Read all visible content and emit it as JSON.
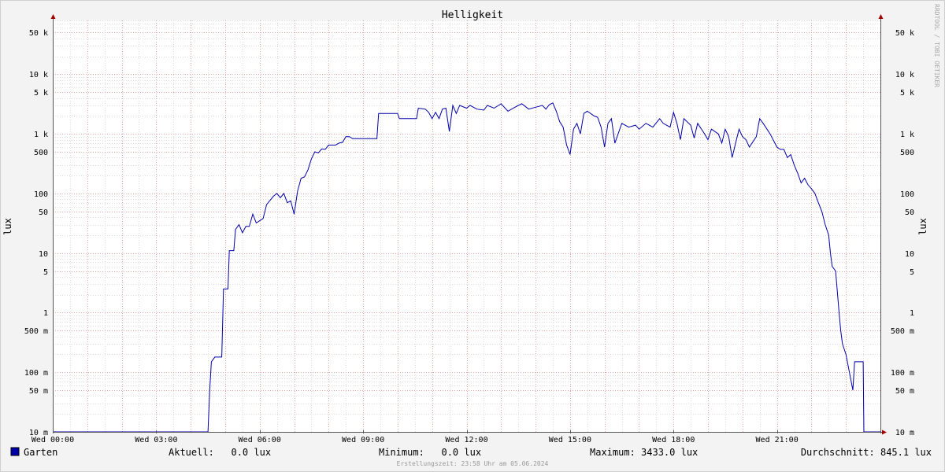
{
  "chart_data": {
    "type": "line",
    "title": "Helligkeit",
    "ylabel": "lux",
    "ylabel_right": "lux",
    "watermark": "RRDTOOL / TOBI OETIKER",
    "yscale": "log",
    "ylim": [
      0.01,
      80000
    ],
    "xlim_hours": [
      0,
      24
    ],
    "y_ticks": [
      {
        "v": 50000,
        "label": "50 k"
      },
      {
        "v": 10000,
        "label": "10 k"
      },
      {
        "v": 5000,
        "label": "5 k"
      },
      {
        "v": 1000,
        "label": "1 k"
      },
      {
        "v": 500,
        "label": "500"
      },
      {
        "v": 100,
        "label": "100"
      },
      {
        "v": 50,
        "label": "50"
      },
      {
        "v": 10,
        "label": "10"
      },
      {
        "v": 5,
        "label": "5"
      },
      {
        "v": 1,
        "label": "1"
      },
      {
        "v": 0.5,
        "label": "500 m"
      },
      {
        "v": 0.1,
        "label": "100 m"
      },
      {
        "v": 0.05,
        "label": "50 m"
      },
      {
        "v": 0.01,
        "label": "10 m"
      }
    ],
    "x_ticks": [
      {
        "h": 0,
        "label": "Wed 00:00"
      },
      {
        "h": 3,
        "label": "Wed 03:00"
      },
      {
        "h": 6,
        "label": "Wed 06:00"
      },
      {
        "h": 9,
        "label": "Wed 09:00"
      },
      {
        "h": 12,
        "label": "Wed 12:00"
      },
      {
        "h": 15,
        "label": "Wed 15:00"
      },
      {
        "h": 18,
        "label": "Wed 18:00"
      },
      {
        "h": 21,
        "label": "Wed 21:00"
      }
    ],
    "series": [
      {
        "name": "Garten",
        "color": "#0000aa",
        "points": [
          [
            0,
            0.01
          ],
          [
            4.5,
            0.01
          ],
          [
            4.55,
            0.05
          ],
          [
            4.6,
            0.15
          ],
          [
            4.7,
            0.18
          ],
          [
            4.9,
            0.18
          ],
          [
            4.95,
            2.5
          ],
          [
            5.08,
            2.5
          ],
          [
            5.12,
            11
          ],
          [
            5.25,
            11
          ],
          [
            5.3,
            25
          ],
          [
            5.4,
            30
          ],
          [
            5.5,
            22
          ],
          [
            5.6,
            28
          ],
          [
            5.7,
            28
          ],
          [
            5.8,
            45
          ],
          [
            5.9,
            32
          ],
          [
            6.1,
            38
          ],
          [
            6.2,
            65
          ],
          [
            6.4,
            90
          ],
          [
            6.5,
            100
          ],
          [
            6.6,
            85
          ],
          [
            6.7,
            100
          ],
          [
            6.8,
            70
          ],
          [
            6.9,
            75
          ],
          [
            7.0,
            45
          ],
          [
            7.1,
            110
          ],
          [
            7.2,
            180
          ],
          [
            7.3,
            190
          ],
          [
            7.4,
            250
          ],
          [
            7.5,
            380
          ],
          [
            7.6,
            500
          ],
          [
            7.7,
            480
          ],
          [
            7.8,
            560
          ],
          [
            7.9,
            550
          ],
          [
            8.0,
            650
          ],
          [
            8.2,
            650
          ],
          [
            8.3,
            700
          ],
          [
            8.4,
            720
          ],
          [
            8.5,
            900
          ],
          [
            8.6,
            900
          ],
          [
            8.7,
            830
          ],
          [
            9.4,
            830
          ],
          [
            9.45,
            2200
          ],
          [
            10.0,
            2200
          ],
          [
            10.05,
            1800
          ],
          [
            10.55,
            1800
          ],
          [
            10.6,
            2700
          ],
          [
            10.8,
            2600
          ],
          [
            10.9,
            2300
          ],
          [
            11.0,
            1800
          ],
          [
            11.1,
            2300
          ],
          [
            11.2,
            1800
          ],
          [
            11.3,
            2600
          ],
          [
            11.4,
            2700
          ],
          [
            11.5,
            1100
          ],
          [
            11.6,
            3000
          ],
          [
            11.7,
            2200
          ],
          [
            11.8,
            3000
          ],
          [
            12.0,
            2700
          ],
          [
            12.1,
            3000
          ],
          [
            12.3,
            2600
          ],
          [
            12.5,
            2500
          ],
          [
            12.6,
            3000
          ],
          [
            12.8,
            2700
          ],
          [
            13.0,
            3200
          ],
          [
            13.2,
            2400
          ],
          [
            13.4,
            2800
          ],
          [
            13.6,
            3200
          ],
          [
            13.8,
            2600
          ],
          [
            14.0,
            2800
          ],
          [
            14.2,
            3000
          ],
          [
            14.3,
            2600
          ],
          [
            14.4,
            3100
          ],
          [
            14.5,
            3300
          ],
          [
            14.6,
            2400
          ],
          [
            14.7,
            1600
          ],
          [
            14.8,
            1300
          ],
          [
            14.9,
            650
          ],
          [
            15.0,
            450
          ],
          [
            15.1,
            1200
          ],
          [
            15.2,
            1500
          ],
          [
            15.3,
            1000
          ],
          [
            15.4,
            2200
          ],
          [
            15.5,
            2400
          ],
          [
            15.7,
            2000
          ],
          [
            15.8,
            1900
          ],
          [
            15.9,
            1300
          ],
          [
            16.0,
            600
          ],
          [
            16.1,
            1500
          ],
          [
            16.2,
            1800
          ],
          [
            16.3,
            700
          ],
          [
            16.5,
            1500
          ],
          [
            16.7,
            1300
          ],
          [
            16.9,
            1400
          ],
          [
            17.0,
            1200
          ],
          [
            17.2,
            1500
          ],
          [
            17.4,
            1300
          ],
          [
            17.6,
            1800
          ],
          [
            17.7,
            1500
          ],
          [
            17.9,
            1300
          ],
          [
            18.0,
            2300
          ],
          [
            18.1,
            1500
          ],
          [
            18.2,
            800
          ],
          [
            18.3,
            1800
          ],
          [
            18.5,
            1400
          ],
          [
            18.6,
            850
          ],
          [
            18.7,
            1500
          ],
          [
            18.9,
            1000
          ],
          [
            19.0,
            800
          ],
          [
            19.1,
            1200
          ],
          [
            19.3,
            1000
          ],
          [
            19.4,
            700
          ],
          [
            19.5,
            1200
          ],
          [
            19.6,
            900
          ],
          [
            19.7,
            400
          ],
          [
            19.8,
            700
          ],
          [
            19.9,
            1200
          ],
          [
            20.0,
            900
          ],
          [
            20.1,
            800
          ],
          [
            20.2,
            600
          ],
          [
            20.4,
            900
          ],
          [
            20.5,
            1800
          ],
          [
            20.6,
            1500
          ],
          [
            20.8,
            1000
          ],
          [
            21.0,
            600
          ],
          [
            21.1,
            550
          ],
          [
            21.2,
            550
          ],
          [
            21.3,
            400
          ],
          [
            21.4,
            450
          ],
          [
            21.5,
            300
          ],
          [
            21.6,
            220
          ],
          [
            21.7,
            150
          ],
          [
            21.8,
            180
          ],
          [
            21.9,
            140
          ],
          [
            22.0,
            120
          ],
          [
            22.1,
            100
          ],
          [
            22.2,
            70
          ],
          [
            22.3,
            50
          ],
          [
            22.4,
            30
          ],
          [
            22.5,
            20
          ],
          [
            22.55,
            10
          ],
          [
            22.6,
            6
          ],
          [
            22.7,
            5
          ],
          [
            22.8,
            1
          ],
          [
            22.85,
            0.5
          ],
          [
            22.9,
            0.3
          ],
          [
            23.0,
            0.2
          ],
          [
            23.1,
            0.1
          ],
          [
            23.2,
            0.05
          ],
          [
            23.25,
            0.15
          ],
          [
            23.5,
            0.15
          ],
          [
            23.52,
            0.01
          ],
          [
            24,
            0.01
          ]
        ]
      }
    ]
  },
  "legend": {
    "swatch_color": "#0000aa",
    "name": "Garten",
    "current": "Aktuell:   0.0 lux",
    "minimum": "Minimum:   0.0 lux",
    "maximum": "Maximum: 3433.0 lux",
    "average": "Durchschnitt: 845.1 lux"
  },
  "footer": "Erstellungszeit: 23:58 Uhr am 05.06.2024"
}
